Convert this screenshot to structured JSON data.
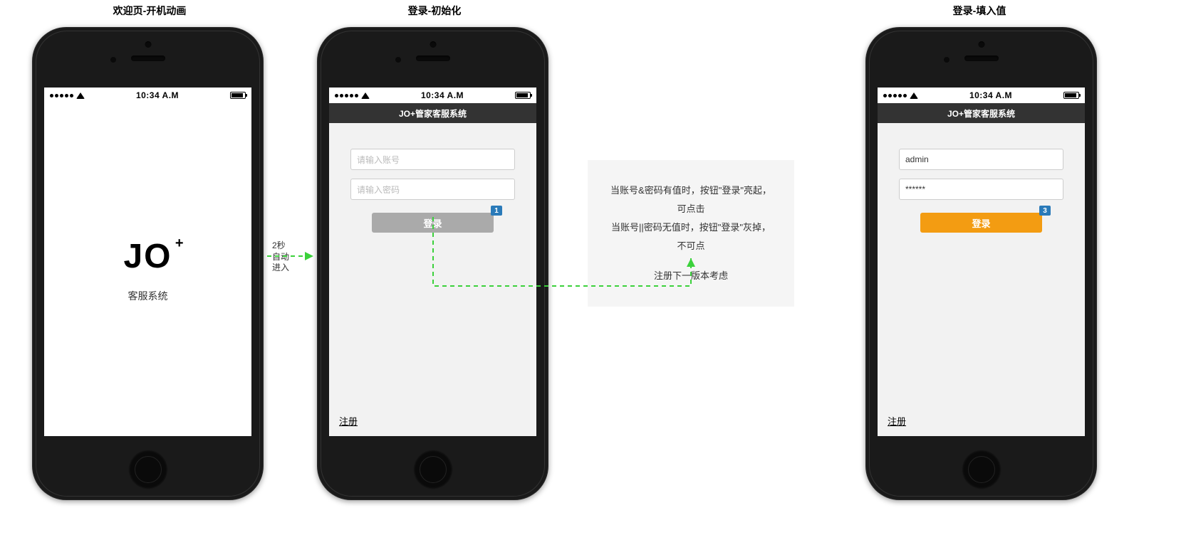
{
  "titles": {
    "screen1": "欢迎页-开机动画",
    "screen2": "登录-初始化",
    "screen3": "登录-填入值"
  },
  "statusbar": {
    "time": "10:34 A.M"
  },
  "splash": {
    "logo": "JO",
    "plus": "+",
    "subtitle": "客服系统"
  },
  "flow": {
    "auto_enter": "2秒\n自动\n进入"
  },
  "login": {
    "header": "JO+管家客服系统",
    "placeholder_account": "请输入账号",
    "placeholder_password": "请输入密码",
    "value_account": "admin",
    "value_password": "******",
    "btn_label": "登录",
    "register": "注册",
    "badge1": "1",
    "badge3": "3"
  },
  "note": {
    "line1": "当账号&密码有值时，按钮\"登录\"亮起，可点击",
    "line2": "当账号||密码无值时，按钮\"登录\"灰掉，不可点",
    "line3": "注册下一版本考虑"
  }
}
